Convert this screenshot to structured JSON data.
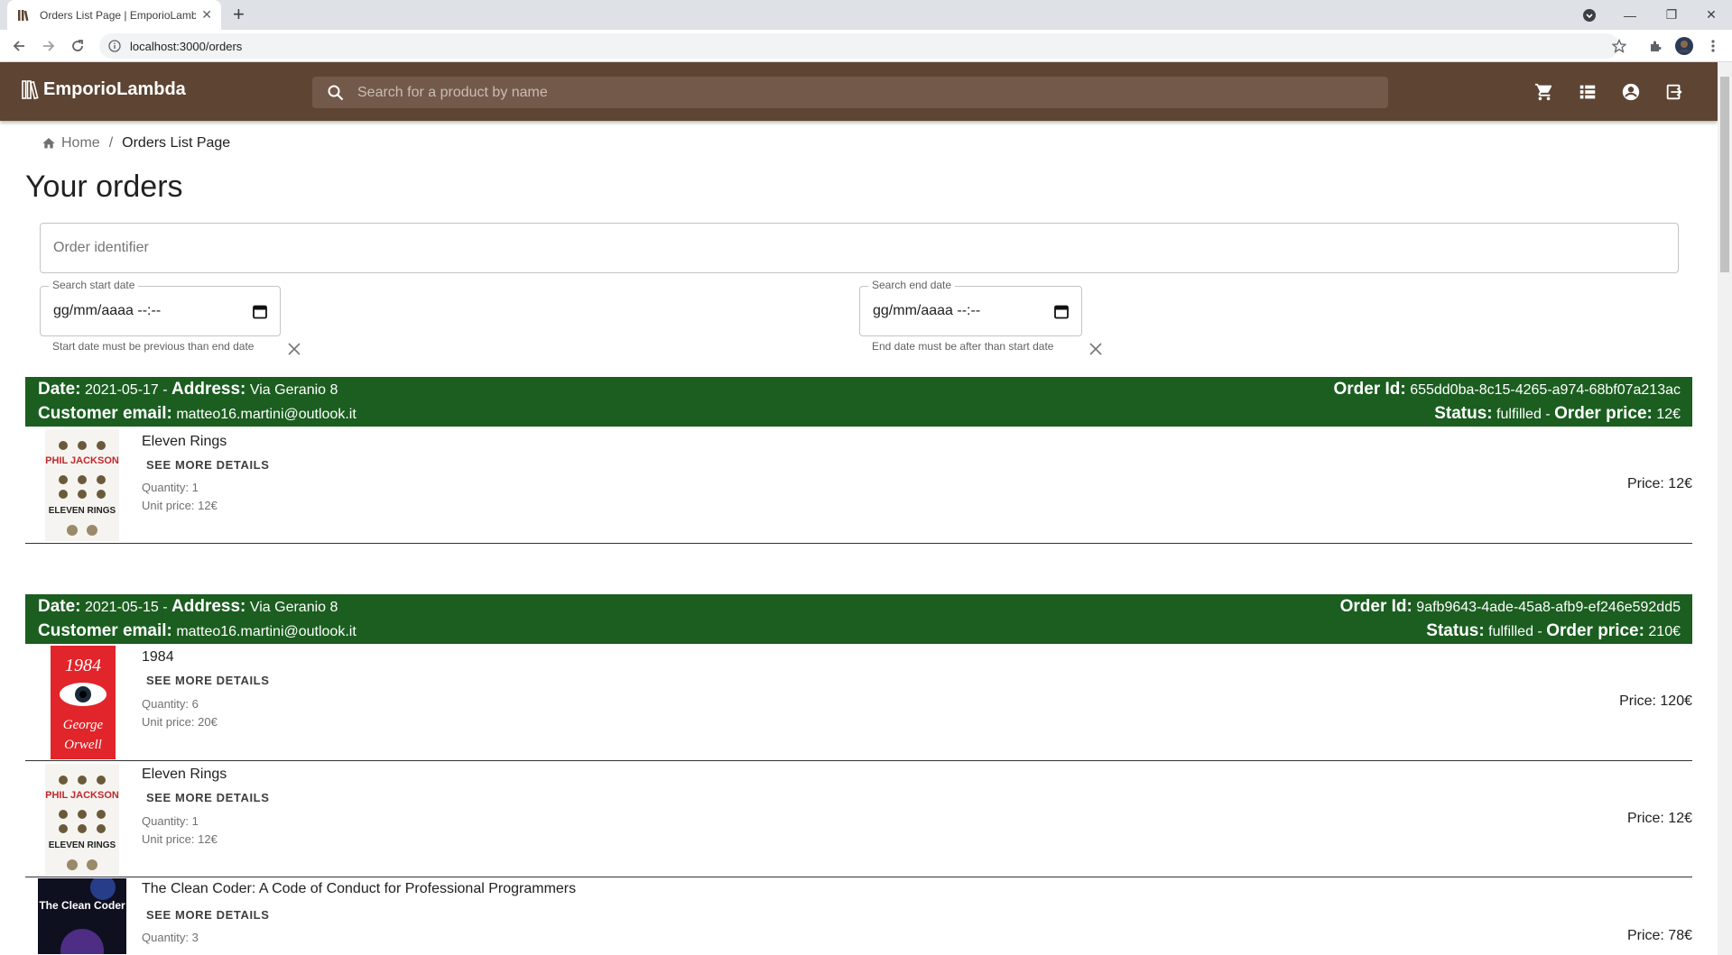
{
  "browser": {
    "tab_title": "Orders List Page | EmporioLambda",
    "url": "localhost:3000/orders"
  },
  "appbar": {
    "brand": "EmporioLambda",
    "search_placeholder": "Search for a product by name",
    "bg_color": "#5d4433"
  },
  "breadcrumb": {
    "home": "Home",
    "separator": "/",
    "current": "Orders List Page"
  },
  "page_title": "Your orders",
  "filters": {
    "order_identifier_placeholder": "Order identifier",
    "start_date_label": "Search start date",
    "start_date_value": "gg/mm/aaaa --:--",
    "start_date_helper": "Start date must be previous than end date",
    "end_date_label": "Search end date",
    "end_date_value": "gg/mm/aaaa --:--",
    "end_date_helper": "End date must be after than start date"
  },
  "labels": {
    "date": "Date:",
    "address": "Address:",
    "customer_email": "Customer email:",
    "order_id": "Order Id:",
    "status": "Status:",
    "order_price": "Order price:",
    "see_more": "SEE MORE DETAILS"
  },
  "orders": [
    {
      "date": "2021-05-17",
      "address": "Via Geranio 8",
      "email": "matteo16.martini@outlook.it",
      "id": "655dd0ba-8c15-4265-a974-68bf07a213ac",
      "status": "fulfilled",
      "price": "12€",
      "items": [
        {
          "title": "Eleven Rings",
          "quantity": "Quantity: 1",
          "unit_price": "Unit price: 12€",
          "price": "Price: 12€",
          "cover": "eleven-rings"
        }
      ]
    },
    {
      "date": "2021-05-15",
      "address": "Via Geranio 8",
      "email": "matteo16.martini@outlook.it",
      "id": "9afb9643-4ade-45a8-afb9-ef246e592dd5",
      "status": "fulfilled",
      "price": "210€",
      "items": [
        {
          "title": "1984",
          "quantity": "Quantity: 6",
          "unit_price": "Unit price: 20€",
          "price": "Price: 120€",
          "cover": "1984"
        },
        {
          "title": "Eleven Rings",
          "quantity": "Quantity: 1",
          "unit_price": "Unit price: 12€",
          "price": "Price: 12€",
          "cover": "eleven-rings"
        },
        {
          "title": "The Clean Coder: A Code of Conduct for Professional Programmers",
          "quantity": "Quantity: 3",
          "unit_price": "",
          "price": "Price: 78€",
          "cover": "clean-coder"
        }
      ]
    }
  ],
  "covers": {
    "eleven_rings_author": "PHIL JACKSON",
    "eleven_rings_title": "ELEVEN RINGS",
    "nineteen_title": "1984",
    "nineteen_author_1": "George",
    "nineteen_author_2": "Orwell",
    "clean_coder_title": "The Clean Coder"
  },
  "status_color": "#1b5e20"
}
